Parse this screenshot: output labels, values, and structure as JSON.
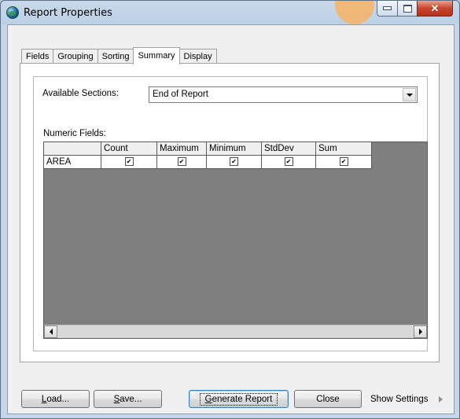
{
  "window": {
    "title": "Report Properties",
    "icon": "globe-icon"
  },
  "tabs": [
    {
      "label": "Fields"
    },
    {
      "label": "Grouping"
    },
    {
      "label": "Sorting"
    },
    {
      "label": "Summary",
      "active": true
    },
    {
      "label": "Display"
    }
  ],
  "summary": {
    "available_sections_label": "Available Sections:",
    "available_sections_value": "End of Report",
    "numeric_fields_label": "Numeric Fields:",
    "grid": {
      "columns": [
        "Count",
        "Maximum",
        "Minimum",
        "StdDev",
        "Sum"
      ],
      "rows": [
        {
          "field": "AREA",
          "checked": [
            true,
            true,
            true,
            true,
            true
          ]
        }
      ]
    }
  },
  "footer": {
    "load_prefix": "L",
    "load_rest": "oad...",
    "save_prefix": "S",
    "save_rest": "ave...",
    "generate_prefix": "G",
    "generate_rest": "enerate Report",
    "close_label": "Close",
    "show_settings_label": "Show Settings"
  },
  "colors": {
    "grid_background": "#7f7f7f",
    "close_button": "#c8452f"
  }
}
